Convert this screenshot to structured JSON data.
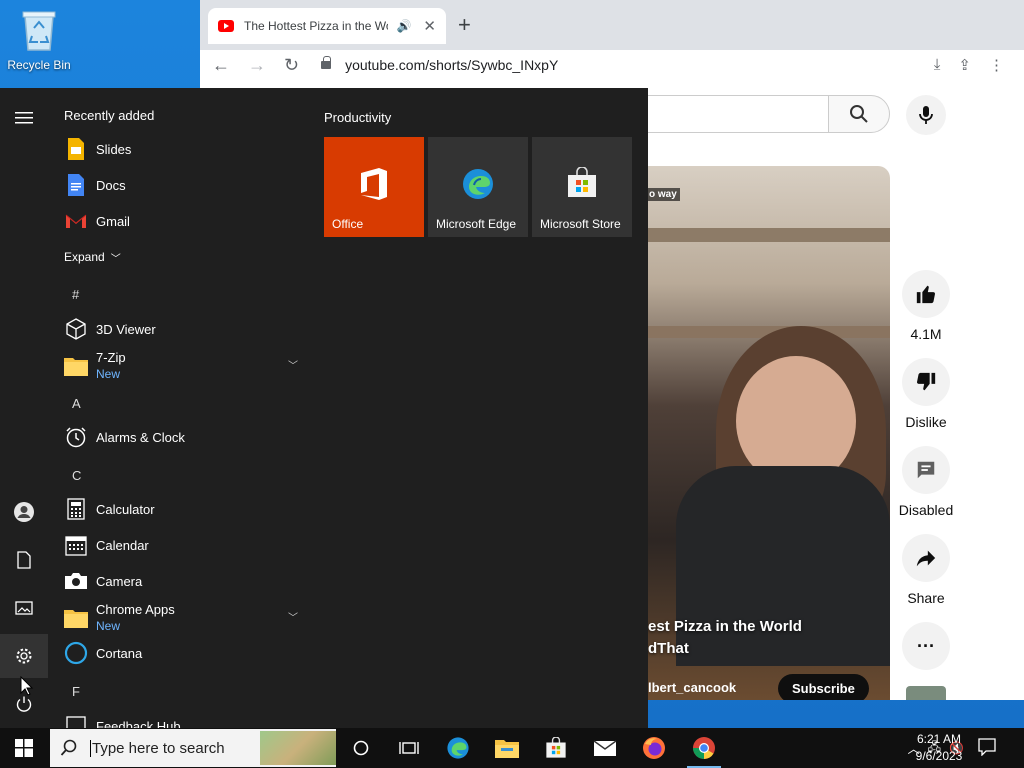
{
  "desktop": {
    "recycle_bin_label": "Recycle Bin"
  },
  "browser": {
    "tab_title": "The Hottest Pizza in the Wor",
    "url": "youtube.com/shorts/Sywbc_INxpY"
  },
  "youtube": {
    "video_caption_top": "o way",
    "video_title_line1": "est Pizza in the World",
    "video_title_line2": "dThat",
    "channel": "lbert_cancook",
    "subscribe_label": "Subscribe",
    "like_count": "4.1M",
    "dislike_label": "Dislike",
    "comments_label": "Disabled",
    "share_label": "Share"
  },
  "start_menu": {
    "recently_added_label": "Recently added",
    "recent_apps": [
      {
        "label": "Slides"
      },
      {
        "label": "Docs"
      },
      {
        "label": "Gmail"
      }
    ],
    "expand_label": "Expand",
    "hash_letter": "#",
    "apps_hash": [
      {
        "label": "3D Viewer"
      },
      {
        "label": "7-Zip",
        "sub": "New"
      }
    ],
    "letter_a": "A",
    "apps_a": [
      {
        "label": "Alarms & Clock"
      }
    ],
    "letter_c": "C",
    "apps_c": [
      {
        "label": "Calculator"
      },
      {
        "label": "Calendar"
      },
      {
        "label": "Camera"
      },
      {
        "label": "Chrome Apps",
        "sub": "New"
      },
      {
        "label": "Cortana"
      }
    ],
    "letter_f": "F",
    "apps_f": [
      {
        "label": "Feedback Hub"
      }
    ],
    "tiles_group": "Productivity",
    "tiles": [
      {
        "label": "Office",
        "color": "#d83b01"
      },
      {
        "label": "Microsoft Edge",
        "color": "#333333"
      },
      {
        "label": "Microsoft Store",
        "color": "#333333"
      }
    ]
  },
  "taskbar": {
    "search_placeholder": "Type here to search",
    "time": "6:21 AM",
    "date": "9/6/2023"
  }
}
